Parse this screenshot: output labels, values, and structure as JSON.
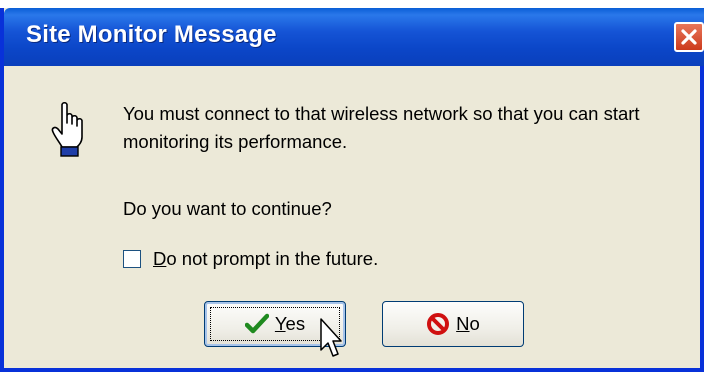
{
  "dialog": {
    "title": "Site Monitor Message",
    "message": "You must connect to that wireless network so that you can start monitoring its performance.",
    "question": "Do you want to continue?",
    "checkbox": {
      "mnemonic": "D",
      "rest": "o not prompt in the future.",
      "checked": false
    },
    "yes_button": {
      "mnemonic": "Y",
      "rest": "es"
    },
    "no_button": {
      "mnemonic": "N",
      "rest": "o"
    },
    "icons": {
      "message_icon": "pointing-hand-icon",
      "close": "close-icon",
      "yes": "checkmark-icon",
      "no": "no-symbol-icon",
      "cursor": "mouse-pointer-icon"
    },
    "colors": {
      "titlebar": "#0a46c8",
      "window_border": "#0831d9",
      "body": "#ece9d8",
      "close_button": "#d94d2c",
      "checkmark": "#1f8a1f",
      "no_symbol": "#d01010"
    }
  }
}
